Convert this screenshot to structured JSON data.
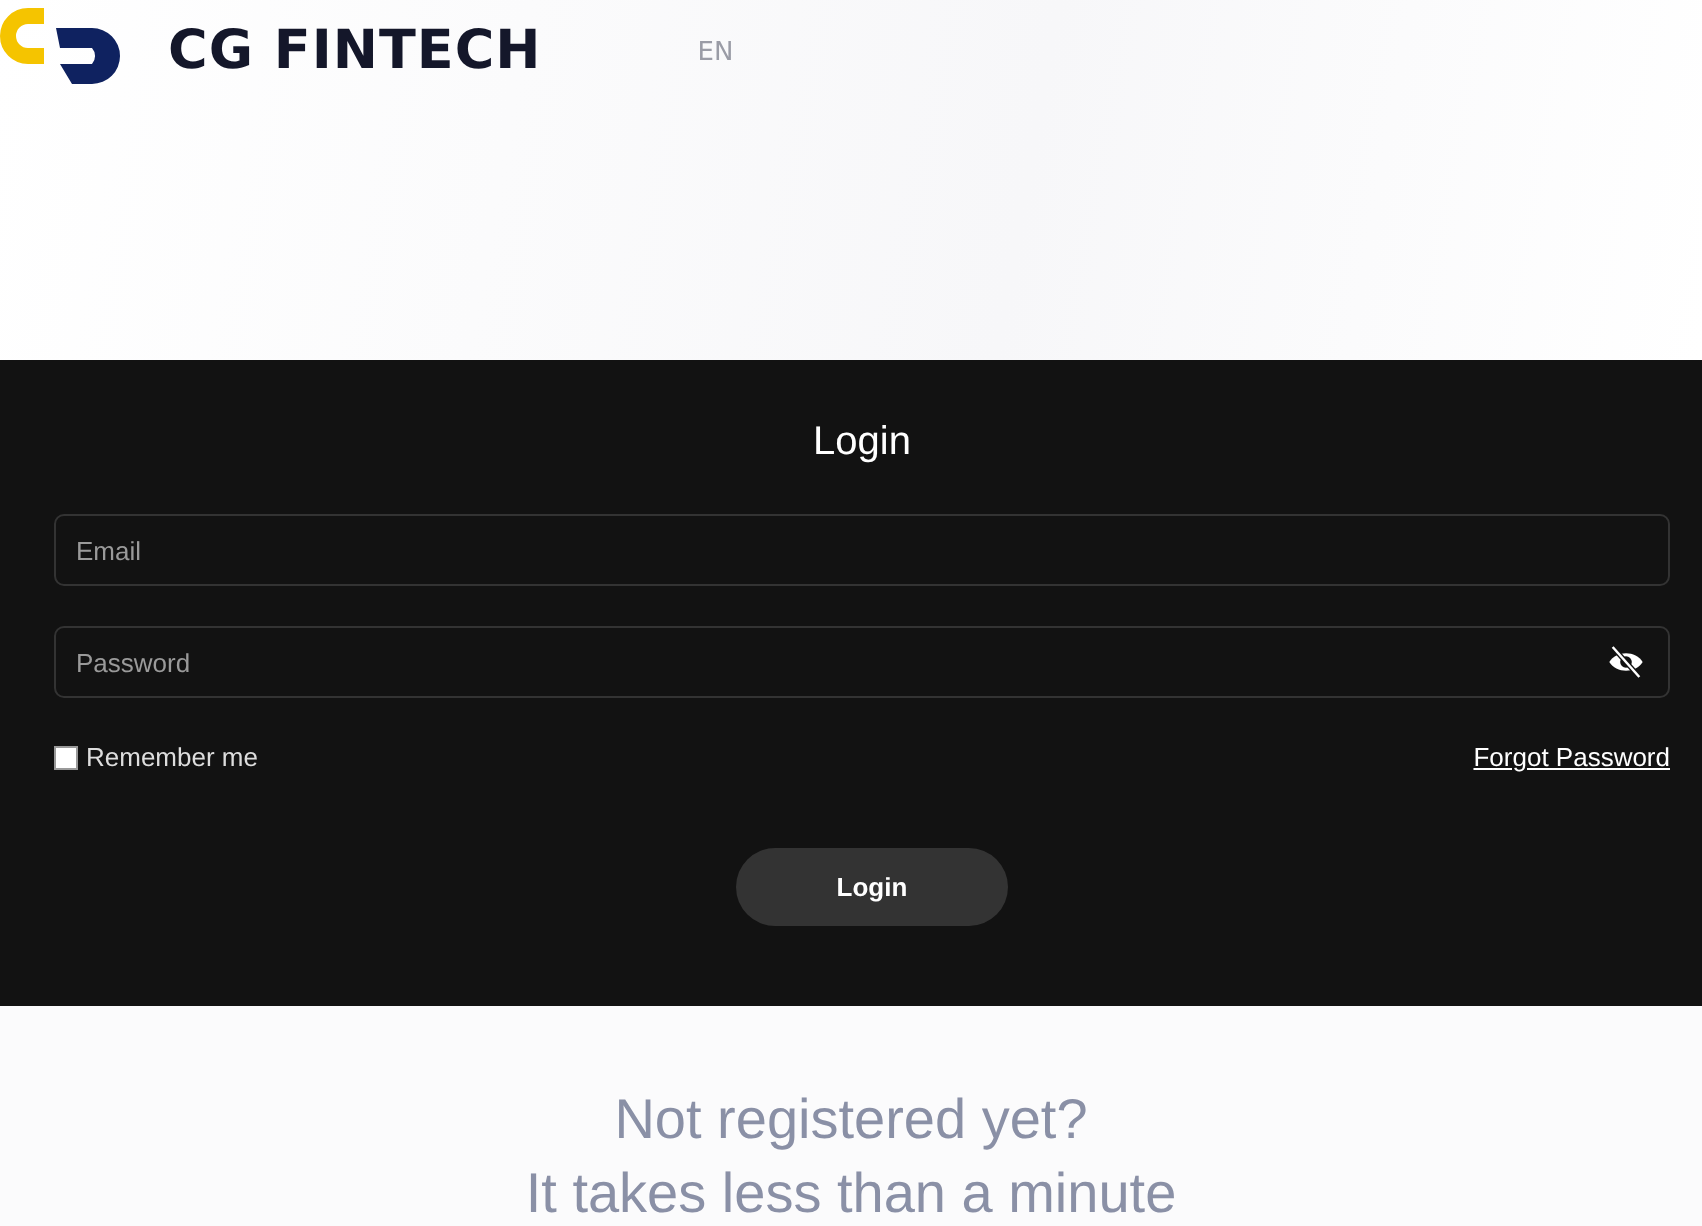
{
  "header": {
    "brand": "CG FINTECH",
    "language": "EN"
  },
  "login_form": {
    "title": "Login",
    "fields": [
      {
        "kind": "email",
        "placeholder": "Email"
      },
      {
        "kind": "password",
        "placeholder": "Password"
      }
    ],
    "remember_me": {
      "label": "Remember me",
      "checked": false
    },
    "forgot_password": "Forgot Password",
    "submit": "Login"
  },
  "signup_prompt": [
    "Not registered yet?",
    "It takes less than a minute"
  ]
}
